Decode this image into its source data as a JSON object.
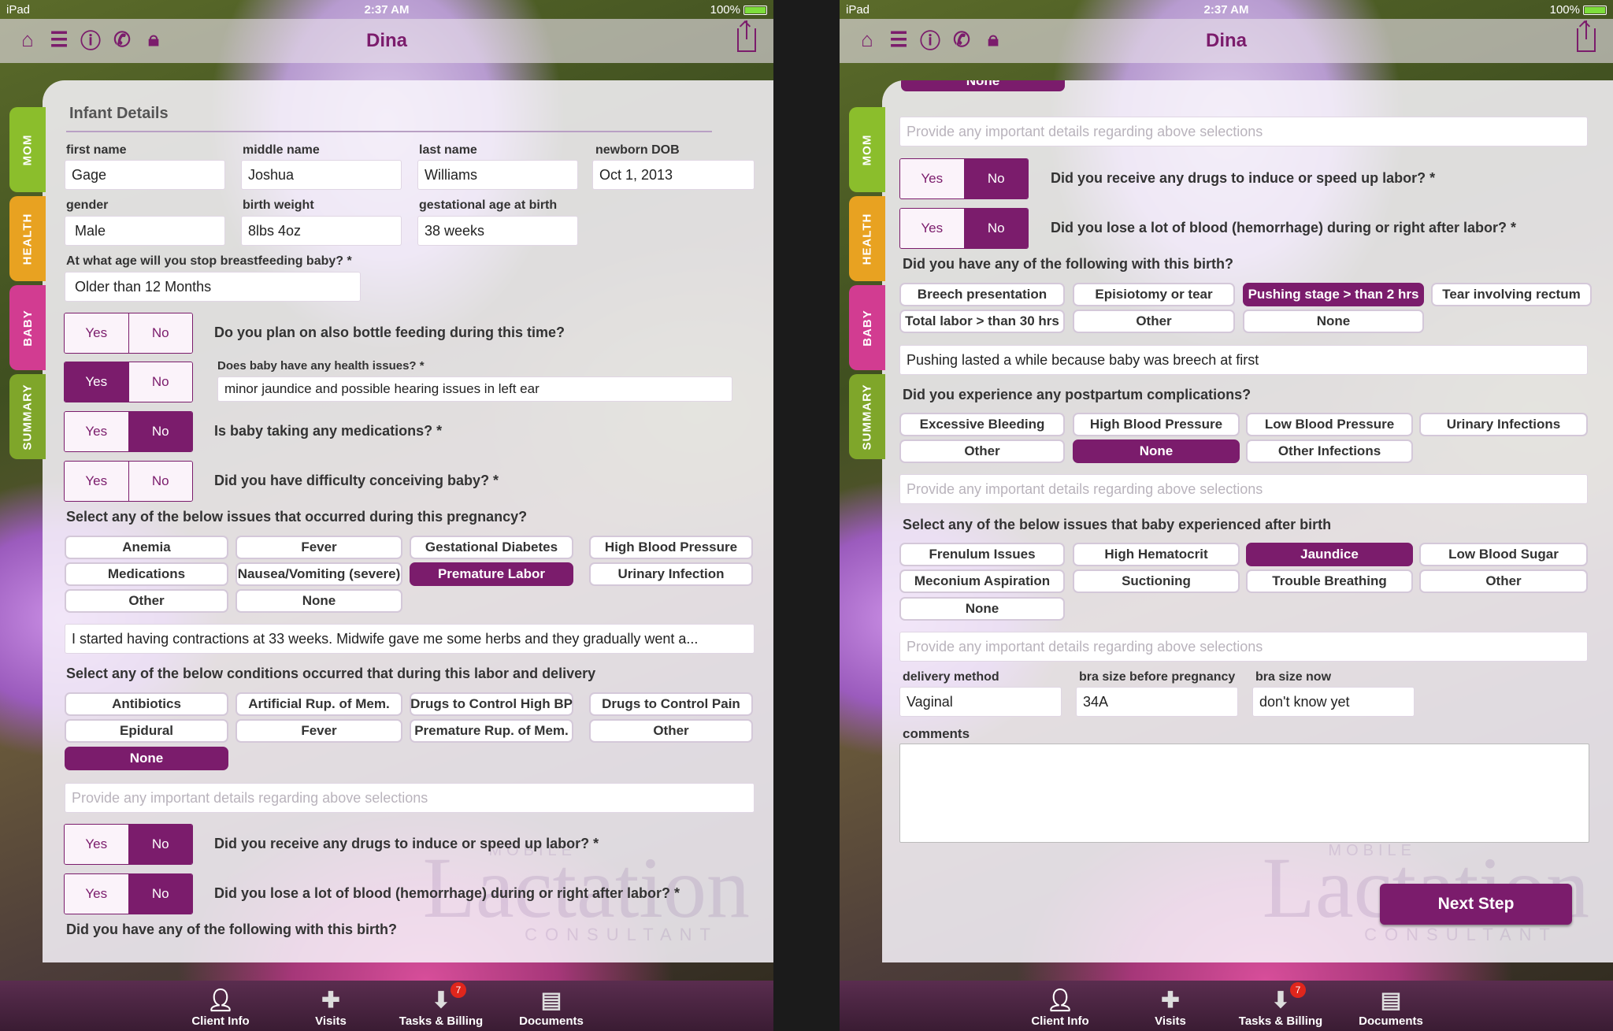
{
  "status": {
    "device": "iPad",
    "time": "2:37 AM",
    "battery": "100%"
  },
  "nav": {
    "title": "Dina"
  },
  "side_tabs": [
    "MOM",
    "HEALTH",
    "BABY",
    "SUMMARY"
  ],
  "tabbar": {
    "client_info": "Client Info",
    "visits": "Visits",
    "tasks": "Tasks & Billing",
    "tasks_badge": "7",
    "documents": "Documents"
  },
  "common": {
    "yes": "Yes",
    "no": "No",
    "details_placeholder": "Provide any important details regarding above selections"
  },
  "left": {
    "section_title": "Infant Details",
    "labels": {
      "first": "first name",
      "middle": "middle name",
      "last": "last name",
      "dob": "newborn DOB",
      "gender": "gender",
      "weight": "birth weight",
      "gest": "gestational age at birth"
    },
    "values": {
      "first": "Gage",
      "middle": "Joshua",
      "last": "Williams",
      "dob": "Oct 1, 2013",
      "gender": "Male",
      "weight": "8lbs 4oz",
      "gest": "38 weeks"
    },
    "breastfeed_q": "At what age will you stop breastfeeding baby? *",
    "breastfeed_v": "Older than 12 Months",
    "q_bottle": "Do you plan on also bottle feeding during this time?",
    "q_health": "Does baby have any health issues? *",
    "health_v": "minor jaundice and possible hearing issues in left ear",
    "q_meds": "Is baby taking any medications? *",
    "q_conceive": "Did you have difficulty conceiving baby? *",
    "preg_q": "Select any of the below issues that occurred during this pregnancy?",
    "preg_opts": [
      "Anemia",
      "Fever",
      "Gestational Diabetes",
      "High Blood Pressure",
      "Medications",
      "Nausea/Vomiting (severe)",
      "Premature Labor",
      "Urinary Infection",
      "Other",
      "None"
    ],
    "preg_text": "I started having contractions at 33 weeks. Midwife gave me some herbs and they gradually went a...",
    "labor_q": "Select any of the below conditions occurred that during this labor and delivery",
    "labor_opts": [
      "Antibiotics",
      "Artificial Rup. of Mem.",
      "Drugs to Control High BP",
      "Drugs to Control Pain",
      "Epidural",
      "Fever",
      "Premature Rup. of Mem.",
      "Other",
      "None"
    ],
    "q_induce": "Did you receive any drugs to induce or speed up labor? *",
    "q_blood": "Did you lose a lot of blood (hemorrhage) during or right after labor? *",
    "q_birth": "Did you have any of the following with this birth?"
  },
  "right": {
    "top_opt": "None",
    "q_induce": "Did you receive any drugs to induce or speed up labor? *",
    "q_blood": "Did you lose a lot of blood (hemorrhage) during or right after labor? *",
    "q_birth": "Did you have any of the following with this birth?",
    "birth_opts": [
      "Breech presentation",
      "Episiotomy or tear",
      "Pushing stage > than 2 hrs",
      "Tear involving rectum",
      "Total labor > than 30 hrs",
      "Other",
      "None"
    ],
    "birth_text": "Pushing lasted a while because baby was breech at first",
    "postpartum_q": "Did you experience any postpartum complications?",
    "post_opts": [
      "Excessive Bleeding",
      "High Blood Pressure",
      "Low Blood Pressure",
      "Urinary Infections",
      "Other",
      "None",
      "Other Infections"
    ],
    "baby_q": "Select any of the below issues that baby experienced after birth",
    "baby_opts": [
      "Frenulum Issues",
      "High Hematocrit",
      "Jaundice",
      "Low Blood Sugar",
      "Meconium Aspiration",
      "Suctioning",
      "Trouble Breathing",
      "Other",
      "None"
    ],
    "labels": {
      "delivery": "delivery method",
      "bra_before": "bra size before pregnancy",
      "bra_now": "bra size now",
      "comments": "comments"
    },
    "values": {
      "delivery": "Vaginal",
      "bra_before": "34A",
      "bra_now": "don't know yet"
    },
    "next": "Next Step"
  },
  "watermark": {
    "top": "MOBILE",
    "main": "Lactation",
    "bottom": "CONSULTANT"
  },
  "colors": {
    "accent": "#7b1c6c",
    "mom_tab": "#8bbe2c",
    "health_tab": "#e8a221",
    "baby_tab": "#d23c91",
    "summary_tab": "#7fa62a",
    "badge": "#e0261c"
  }
}
